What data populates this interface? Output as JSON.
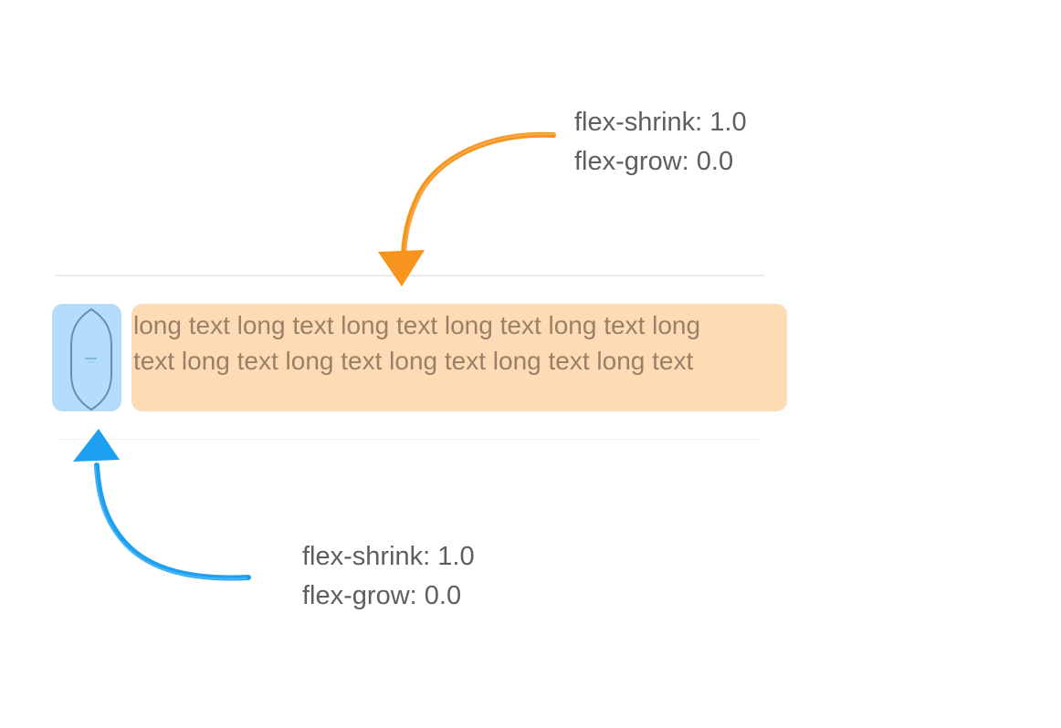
{
  "text_item": {
    "text": "long text long text long text long text long text long text long text long text long text long text long text"
  },
  "orange_annotation": {
    "line1": "flex-shrink: 1.0",
    "line2": "flex-grow: 0.0",
    "color": "#f7941d"
  },
  "blue_annotation": {
    "line1": "flex-shrink: 1.0",
    "line2": "flex-grow: 0.0",
    "color": "#1ea0f1"
  },
  "colors": {
    "item_box_fill": "#b3ddfb",
    "text_box_fill": "#fddcb5",
    "label_text": "#5e5e5e",
    "divider": "#ececec"
  }
}
